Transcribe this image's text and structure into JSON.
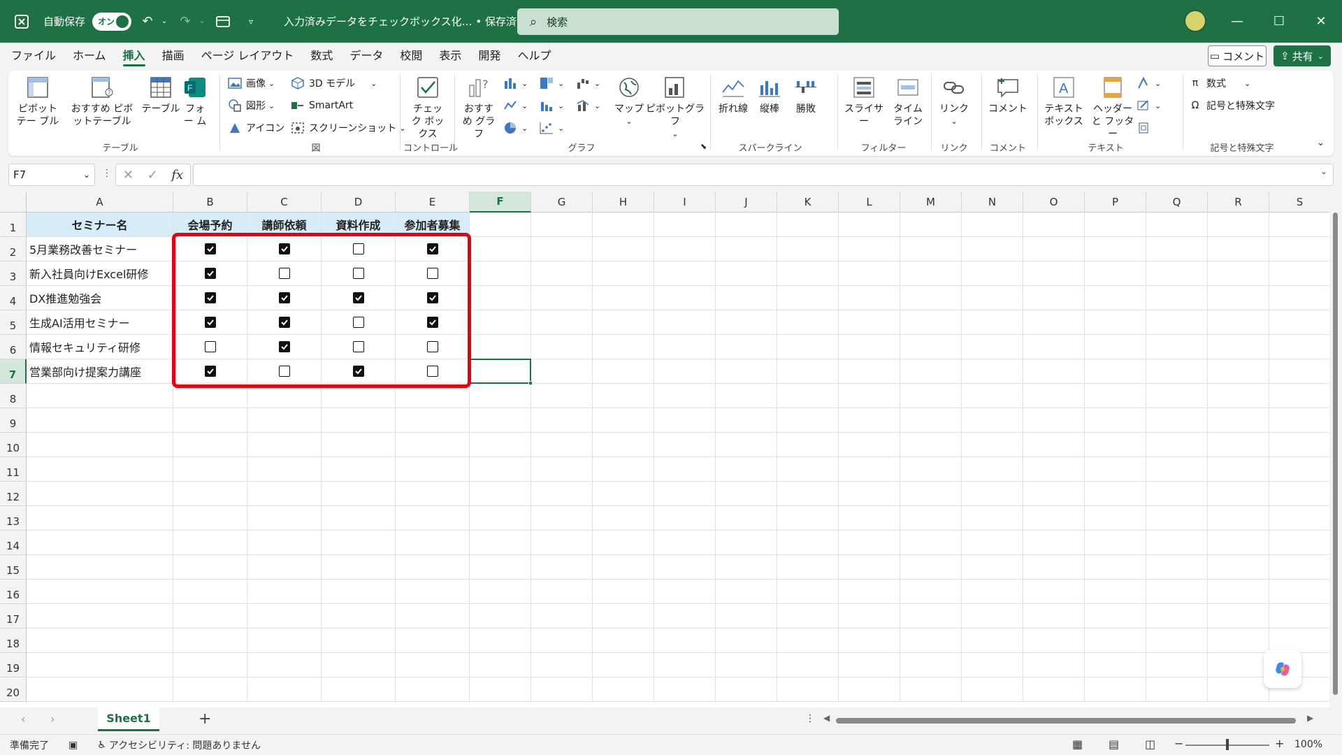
{
  "titlebar": {
    "autosave_label": "自動保存",
    "toggle_label": "オン",
    "filename": "入力済みデータをチェックボックス化… • 保存済み",
    "search_placeholder": "検索"
  },
  "menu": {
    "tabs": [
      "ファイル",
      "ホーム",
      "挿入",
      "描画",
      "ページ レイアウト",
      "数式",
      "データ",
      "校閲",
      "表示",
      "開発",
      "ヘルプ"
    ],
    "active": "挿入",
    "comment_label": "コメント",
    "share_label": "共有"
  },
  "ribbon": {
    "pivot_table": "ピボットテー ブル",
    "recommended_pivot": "おすすめ ピボットテーブル",
    "table": "テーブル",
    "forms": "フォー ム",
    "image": "画像",
    "shapes": "図形",
    "icons": "アイコン",
    "model3d": "3D モデル",
    "smartart": "SmartArt",
    "screenshot": "スクリーンショット",
    "checkbox": "チェック ボックス",
    "recommended_charts": "おすすめ グラフ",
    "maps": "マップ",
    "pivot_chart": "ピボットグラフ",
    "line": "折れ線",
    "column": "縦棒",
    "win_loss": "勝敗",
    "slicer": "スライサー",
    "timeline": "タイム ライン",
    "link": "リンク",
    "comment": "コメント",
    "textbox": "テキスト ボックス",
    "header_footer": "ヘッダーと フッター",
    "equation": "数式",
    "symbol": "記号と特殊文字",
    "groups": {
      "tables": "テーブル",
      "illustrations": "図",
      "controls": "コントロール",
      "charts": "グラフ",
      "sparklines": "スパークライン",
      "filters": "フィルター",
      "links": "リンク",
      "comments": "コメント",
      "text": "テキスト",
      "symbols": "記号と特殊文字"
    }
  },
  "formula_bar": {
    "name_box": "F7",
    "fx": "fx"
  },
  "sheet": {
    "columns": [
      "A",
      "B",
      "C",
      "D",
      "E",
      "F",
      "G",
      "H",
      "I",
      "J",
      "K",
      "L",
      "M",
      "N",
      "O",
      "P",
      "Q",
      "R",
      "S"
    ],
    "rows": [
      "1",
      "2",
      "3",
      "4",
      "5",
      "6",
      "7",
      "8",
      "9",
      "10",
      "11",
      "12",
      "13",
      "14",
      "15",
      "16",
      "17",
      "18",
      "19",
      "20"
    ],
    "headers": [
      "セミナー名",
      "会場予約",
      "講師依頼",
      "資料作成",
      "参加者募集"
    ],
    "seminars": [
      {
        "name": "5月業務改善セミナー",
        "checks": [
          true,
          true,
          false,
          true
        ]
      },
      {
        "name": "新入社員向けExcel研修",
        "checks": [
          true,
          false,
          false,
          false
        ]
      },
      {
        "name": "DX推進勉強会",
        "checks": [
          true,
          true,
          true,
          true
        ]
      },
      {
        "name": "生成AI活用セミナー",
        "checks": [
          true,
          true,
          false,
          true
        ]
      },
      {
        "name": "情報セキュリティ研修",
        "checks": [
          false,
          true,
          false,
          false
        ]
      },
      {
        "name": "営業部向け提案力講座",
        "checks": [
          true,
          false,
          true,
          false
        ]
      }
    ],
    "selected_cell": "F7"
  },
  "sheet_tabs": {
    "active": "Sheet1",
    "add_label": "+"
  },
  "status": {
    "ready": "準備完了",
    "accessibility": "アクセシビリティ: 問題ありません",
    "zoom": "100%"
  },
  "colors": {
    "accent": "#1e7145",
    "header_fill": "#d6ecf8",
    "highlight": "#e60012"
  }
}
